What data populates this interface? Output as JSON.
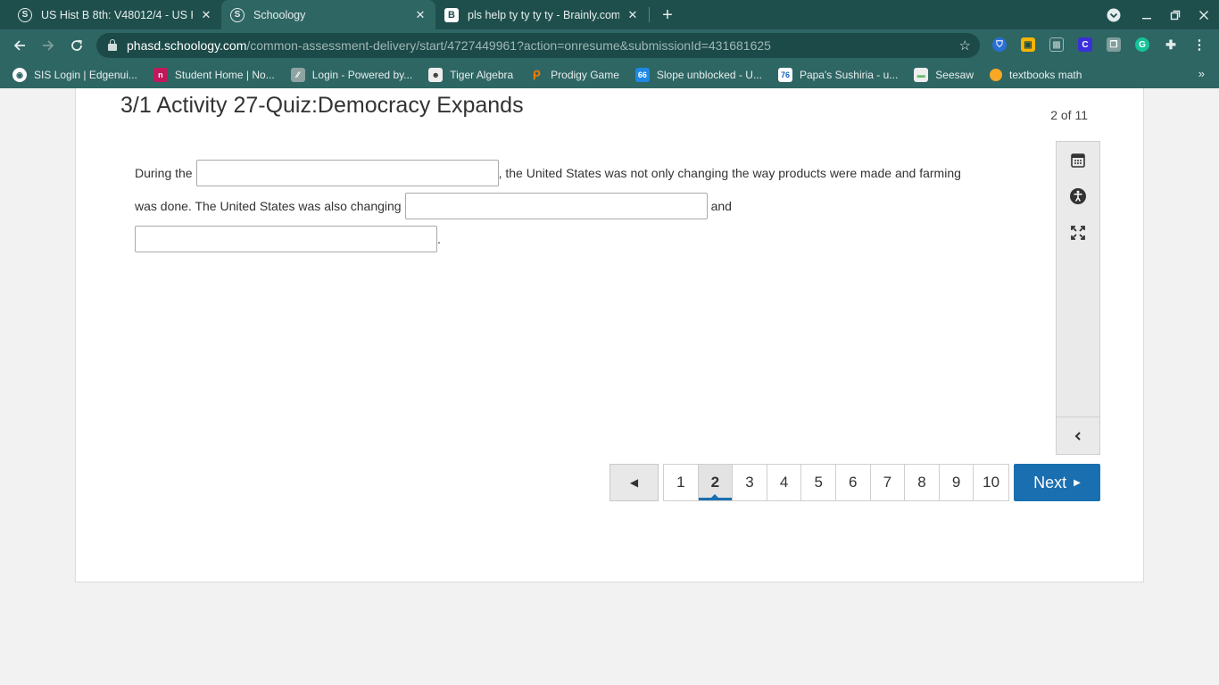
{
  "browser": {
    "tabs": [
      {
        "label": "US Hist B 8th: V48012/4 - US His",
        "favicon": "S",
        "active": false
      },
      {
        "label": "Schoology",
        "favicon": "S",
        "active": true
      },
      {
        "label": "pls help ty ty ty ty - Brainly.com",
        "favicon": "B",
        "active": false
      }
    ],
    "url_host": "phasd.schoology.com",
    "url_path": "/common-assessment-delivery/start/4727449961?action=onresume&submissionId=431681625",
    "bookmarks": [
      {
        "label": "SIS Login | Edgenui...",
        "color": "#ffffff"
      },
      {
        "label": "Student Home | No...",
        "color": "#c2185b"
      },
      {
        "label": "Login - Powered by...",
        "color": "#8fa3a2"
      },
      {
        "label": "Tiger Algebra",
        "color": "#dddddd"
      },
      {
        "label": "Prodigy Game",
        "color": "#f57c00"
      },
      {
        "label": "Slope unblocked - U...",
        "color": "#1e88e5"
      },
      {
        "label": "Papa's Sushiria - u...",
        "color": "#1565c0"
      },
      {
        "label": "Seesaw",
        "color": "#66bb6a"
      },
      {
        "label": "textbooks math",
        "color": "#f9a825"
      }
    ],
    "bookmark_icon_text": {
      "seventy_six": "76",
      "sixty_six": "66",
      "n": "n"
    }
  },
  "quiz": {
    "title": "3/1 Activity 27-Quiz:Democracy Expands",
    "counter": "2 of 11",
    "question": {
      "part1": "During the",
      "part2": ", the United States was not only changing the way products were made and farming",
      "part3": "was done. The United States was also changing",
      "part4": "and",
      "part5": ".",
      "blank1_value": "",
      "blank2_value": "",
      "blank3_value": ""
    },
    "pagination": {
      "pages": [
        "1",
        "2",
        "3",
        "4",
        "5",
        "6",
        "7",
        "8",
        "9",
        "10"
      ],
      "current": "2",
      "prev_symbol": "◀",
      "next_label": "Next",
      "next_symbol": "▶"
    }
  },
  "colors": {
    "tab_bar": "#1f4f4d",
    "toolbar": "#2e6664",
    "accent": "#1a6fb0"
  }
}
